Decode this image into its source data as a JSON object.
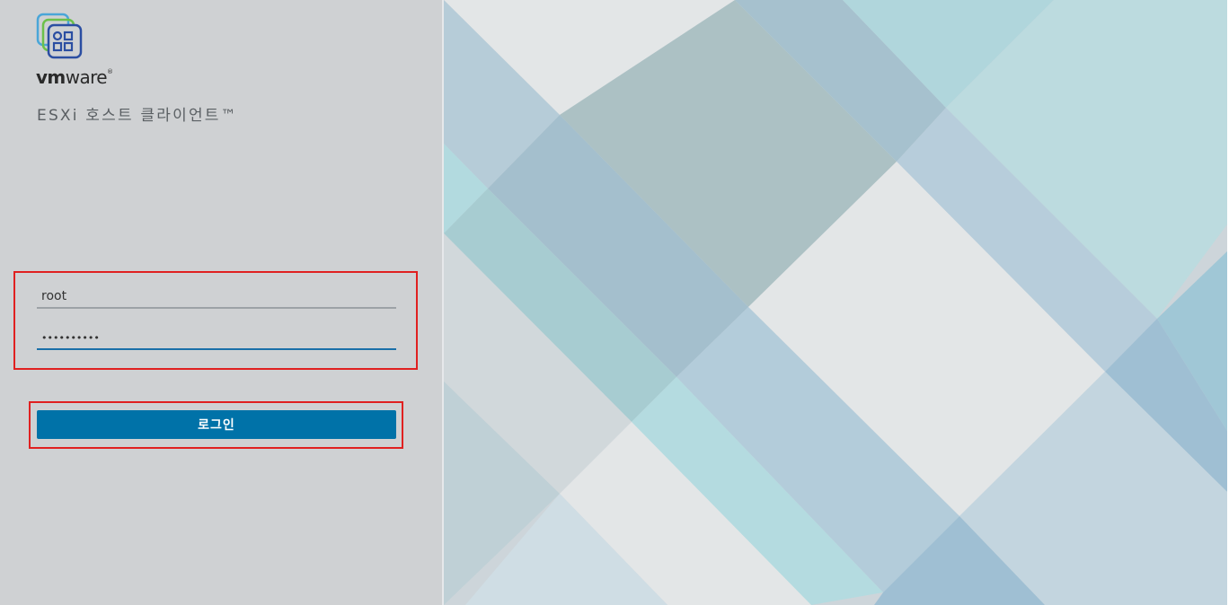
{
  "brand": {
    "wordmark_bold": "vm",
    "wordmark_light": "ware",
    "registered": "®",
    "product_name": "ESXi 호스트 클라이언트™"
  },
  "login_form": {
    "username_value": "root",
    "password_value": "••••••••••",
    "login_label": "로그인"
  },
  "colors": {
    "accent": "#0072a8",
    "highlight_border": "#e02020",
    "left_panel_bg": "#cfd1d3"
  }
}
